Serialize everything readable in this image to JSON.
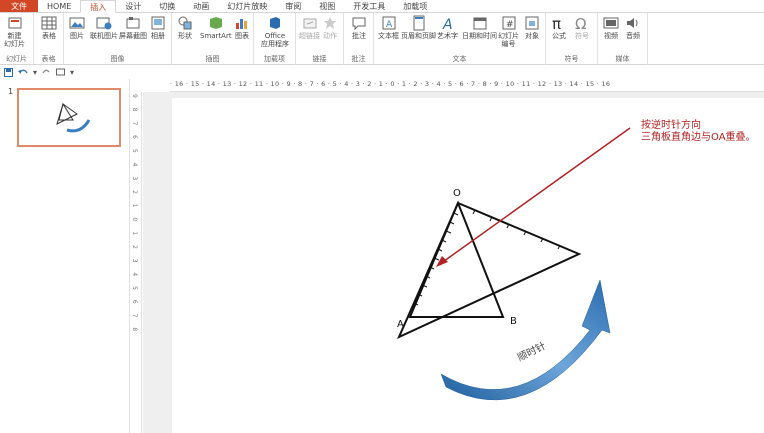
{
  "tabs": [
    {
      "label": "文件"
    },
    {
      "label": "HOME"
    },
    {
      "label": "插入"
    },
    {
      "label": "设计"
    },
    {
      "label": "切换"
    },
    {
      "label": "动画"
    },
    {
      "label": "幻灯片放映"
    },
    {
      "label": "审阅"
    },
    {
      "label": "视图"
    },
    {
      "label": "开发工具"
    },
    {
      "label": "加载项"
    }
  ],
  "ribbon": {
    "groups": [
      {
        "label": "幻灯片",
        "buttons": [
          {
            "label": "新建\n幻灯片"
          }
        ]
      },
      {
        "label": "表格",
        "buttons": [
          {
            "label": "表格"
          }
        ]
      },
      {
        "label": "图像",
        "buttons": [
          {
            "label": "图片"
          },
          {
            "label": "联机图片"
          },
          {
            "label": "屏幕截图"
          },
          {
            "label": "相册"
          }
        ]
      },
      {
        "label": "插图",
        "buttons": [
          {
            "label": "形状"
          },
          {
            "label": "SmartArt"
          },
          {
            "label": "图表"
          }
        ]
      },
      {
        "label": "加载项",
        "buttons": [
          {
            "label": "Office\n应用程序"
          }
        ]
      },
      {
        "label": "链接",
        "buttons": [
          {
            "label": "超链接"
          },
          {
            "label": "动作"
          }
        ]
      },
      {
        "label": "批注",
        "buttons": [
          {
            "label": "批注"
          }
        ]
      },
      {
        "label": "文本",
        "buttons": [
          {
            "label": "文本框"
          },
          {
            "label": "页眉和页脚"
          },
          {
            "label": "艺术字"
          },
          {
            "label": "日期和时间"
          },
          {
            "label": "幻灯片\n编号"
          },
          {
            "label": "对象"
          }
        ]
      },
      {
        "label": "符号",
        "buttons": [
          {
            "label": "公式"
          },
          {
            "label": "符号"
          }
        ]
      },
      {
        "label": "媒体",
        "buttons": [
          {
            "label": "视频"
          },
          {
            "label": "音频"
          }
        ]
      }
    ]
  },
  "ruler": {
    "labels": "· 16 · 15 · 14 · 13 · 12 · 11 · 10 · 9 · 8 · 7 · 6 · 5 · 4 · 3 · 2 · 1 · 0 · 1 · 2 · 3 · 4 · 5 · 6 · 7 · 8 · 9 · 10 · 11 · 12 · 13 · 14 · 15 · 16"
  },
  "vruler": {
    "labels": "9 8 7 6 5 4 3 2 1 0 1 2 3 4 5 6 7 8"
  },
  "thumbnail": {
    "number": "1"
  },
  "slide": {
    "note_line1": "按逆时针方向",
    "note_line2": "三角板直角边与OA重叠。",
    "point_o": "O",
    "point_a": "A",
    "point_b": "B",
    "arc_label": "顺时针"
  },
  "colors": {
    "file_tab": "#d24726",
    "thumb_border": "#e08a6a",
    "note_red": "#b22222",
    "arrow_blue": "#3c7fc0"
  }
}
